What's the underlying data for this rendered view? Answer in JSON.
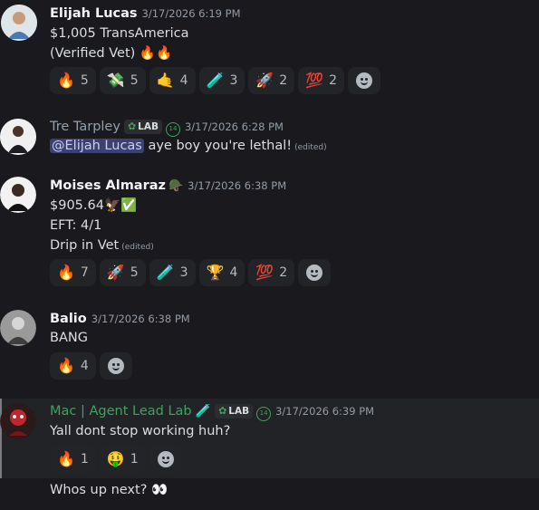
{
  "messages": [
    {
      "username": "Elijah Lucas",
      "timestamp": "3/17/2026 6:19 PM",
      "lines": [
        "$1,005 TransAmerica",
        "(Verified Vet) 🔥🔥"
      ],
      "reactions": [
        {
          "emoji": "🔥",
          "count": "5"
        },
        {
          "emoji": "💸",
          "count": "5"
        },
        {
          "emoji": "🤙",
          "count": "4"
        },
        {
          "emoji": "🧪",
          "count": "3"
        },
        {
          "emoji": "🚀",
          "count": "2"
        },
        {
          "emoji": "💯",
          "count": "2"
        }
      ]
    },
    {
      "username": "Tre Tarpley",
      "tag": "LAB",
      "timestamp": "3/17/2026 6:28 PM",
      "mention": "@Elijah Lucas",
      "text": "aye boy you're lethal!",
      "edited": "(edited)"
    },
    {
      "username": "Moises Almaraz",
      "timestamp": "3/17/2026 6:38 PM",
      "lines": [
        "$905.64🦅✅",
        "EFT: 4/1",
        "Drip in Vet"
      ],
      "edited": "(edited)",
      "reactions": [
        {
          "emoji": "🔥",
          "count": "7"
        },
        {
          "emoji": "🚀",
          "count": "5"
        },
        {
          "emoji": "🧪",
          "count": "3"
        },
        {
          "emoji": "🏆",
          "count": "4"
        },
        {
          "emoji": "💯",
          "count": "2"
        }
      ]
    },
    {
      "username": "Balio",
      "timestamp": "3/17/2026 6:38 PM",
      "lines": [
        "BANG"
      ],
      "reactions": [
        {
          "emoji": "🔥",
          "count": "4"
        }
      ]
    },
    {
      "username": "Mac | Agent Lead Lab",
      "username_color": "#3ba55d",
      "tag": "LAB",
      "timestamp": "3/17/2026 6:39 PM",
      "lines": [
        "Yall dont stop working huh?"
      ],
      "reactions": [
        {
          "emoji": "🔥",
          "count": "1"
        },
        {
          "emoji": "🤑",
          "count": "1"
        }
      ]
    }
  ],
  "trailing_message": "Whos up next? 👀"
}
